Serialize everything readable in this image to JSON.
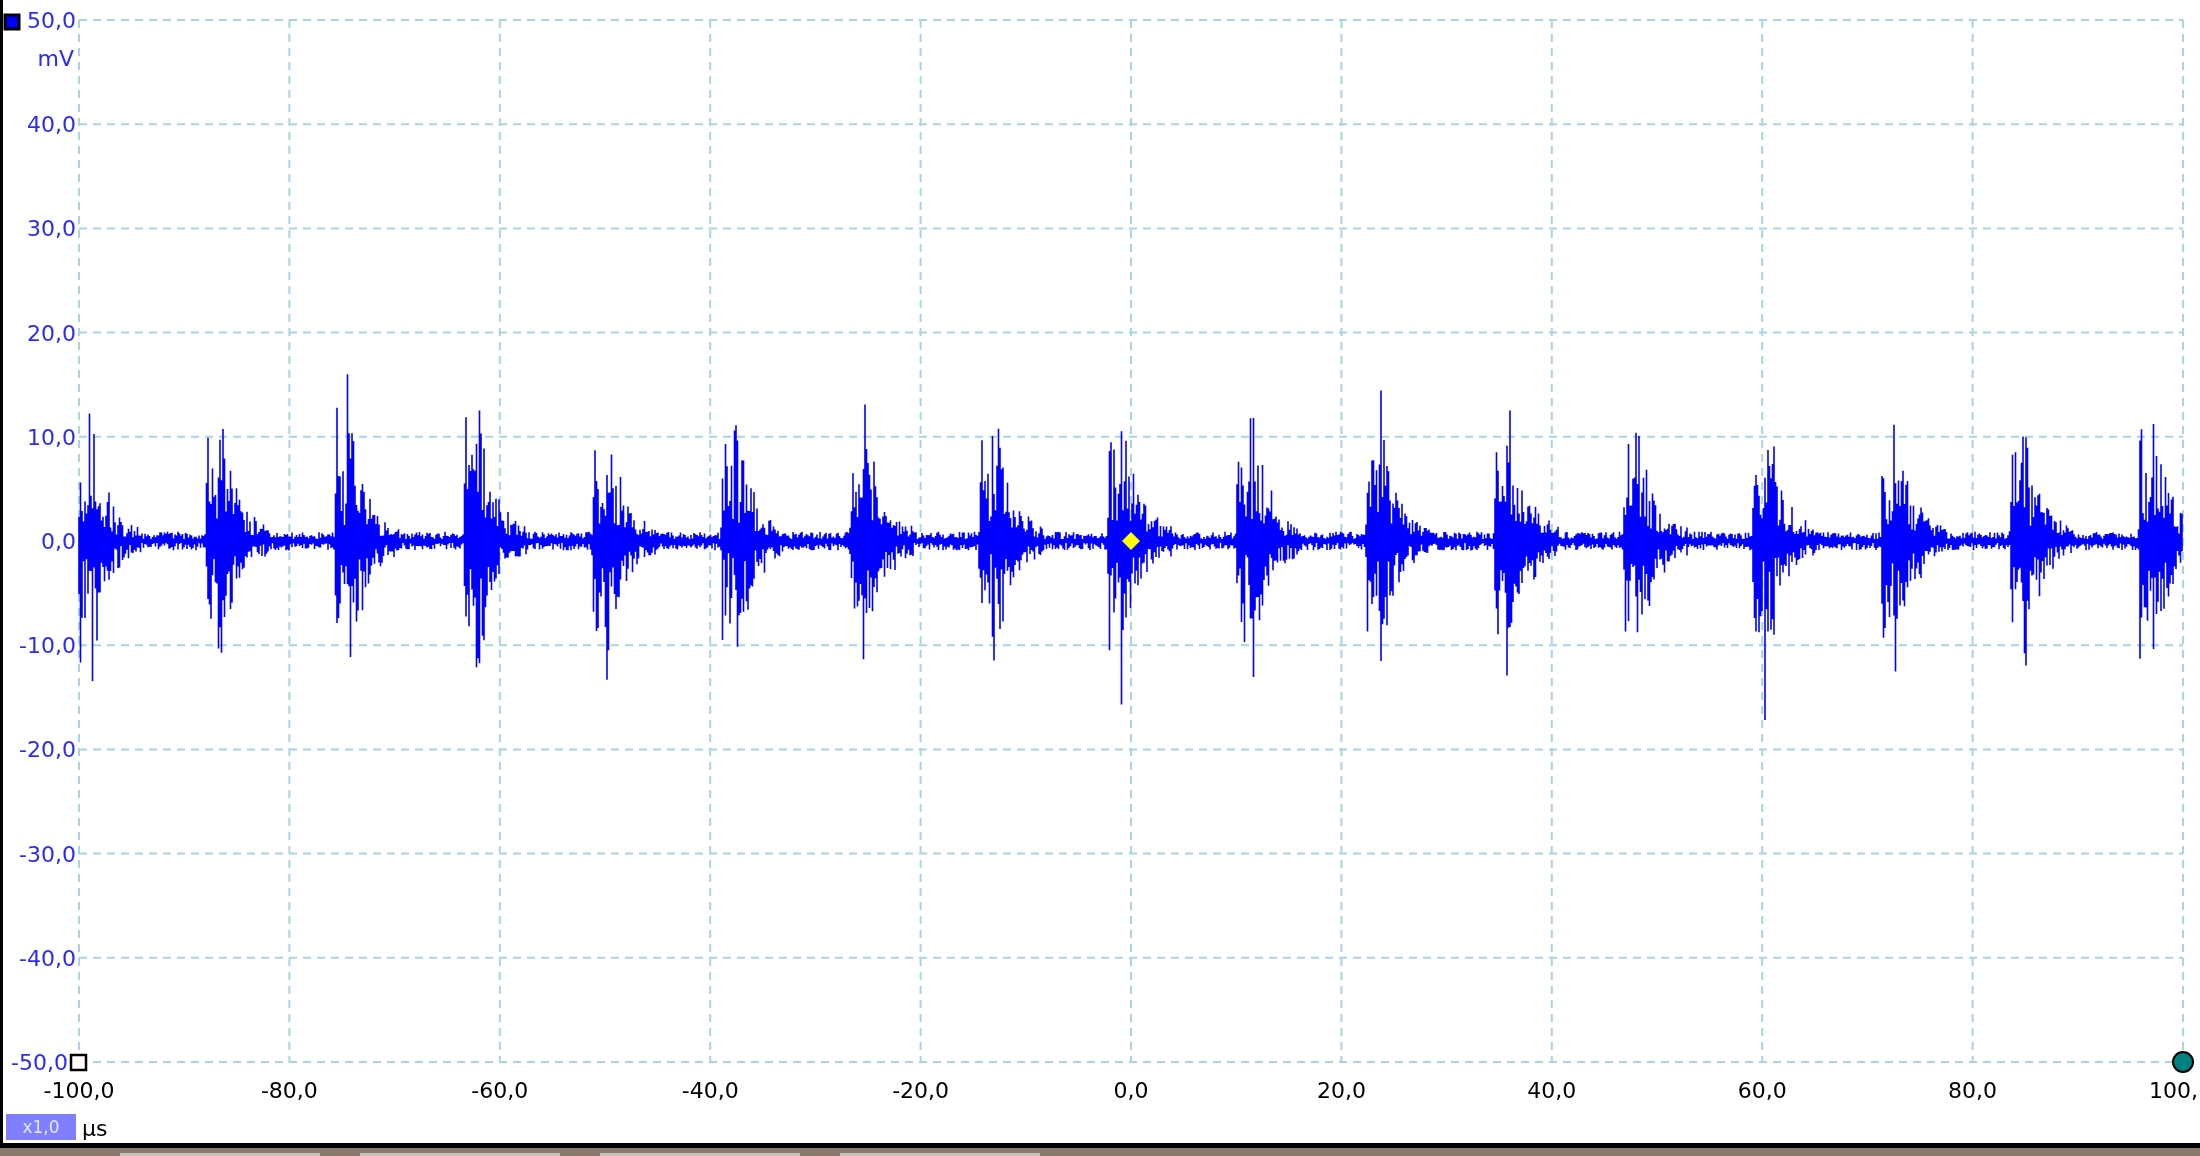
{
  "y_axis": {
    "unit": "mV",
    "labels": [
      "50,0",
      "40,0",
      "30,0",
      "20,0",
      "10,0",
      "0,0",
      "-10,0",
      "-20,0",
      "-30,0",
      "-40,0",
      "-50,0"
    ]
  },
  "x_axis": {
    "unit": "μs",
    "labels": [
      "-100,0",
      "-80,0",
      "-60,0",
      "-40,0",
      "-20,0",
      "0,0",
      "20,0",
      "40,0",
      "60,0",
      "80,0",
      "100,"
    ]
  },
  "zoom_badge": "x1,0"
}
